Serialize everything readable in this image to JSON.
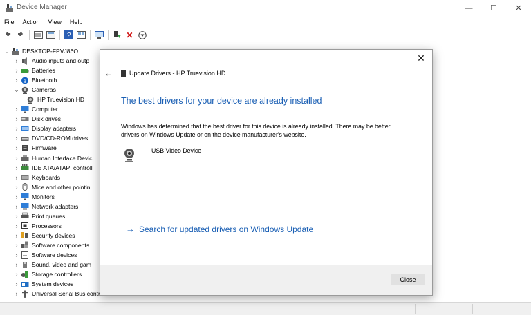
{
  "window": {
    "title": "Device Manager"
  },
  "menu": [
    "File",
    "Action",
    "View",
    "Help"
  ],
  "tree": {
    "root": "DESKTOP-FPVJ86O",
    "items": [
      {
        "label": "Audio inputs and outp",
        "icon": "speaker-icon"
      },
      {
        "label": "Batteries",
        "icon": "battery-icon"
      },
      {
        "label": "Bluetooth",
        "icon": "bluetooth-icon"
      },
      {
        "label": "Cameras",
        "icon": "camera-icon"
      },
      {
        "label": "HP Truevision HD",
        "icon": "webcam-icon"
      },
      {
        "label": "Computer",
        "icon": "monitor-icon"
      },
      {
        "label": "Disk drives",
        "icon": "disk-icon"
      },
      {
        "label": "Display adapters",
        "icon": "display-icon"
      },
      {
        "label": "DVD/CD-ROM drives",
        "icon": "dvd-icon"
      },
      {
        "label": "Firmware",
        "icon": "firmware-icon"
      },
      {
        "label": "Human Interface Devic",
        "icon": "hid-icon"
      },
      {
        "label": "IDE ATA/ATAPI controll",
        "icon": "ide-icon"
      },
      {
        "label": "Keyboards",
        "icon": "keyboard-icon"
      },
      {
        "label": "Mice and other pointin",
        "icon": "mouse-icon"
      },
      {
        "label": "Monitors",
        "icon": "monitor-icon"
      },
      {
        "label": "Network adapters",
        "icon": "network-icon"
      },
      {
        "label": "Print queues",
        "icon": "printer-icon"
      },
      {
        "label": "Processors",
        "icon": "cpu-icon"
      },
      {
        "label": "Security devices",
        "icon": "security-icon"
      },
      {
        "label": "Software components",
        "icon": "component-icon"
      },
      {
        "label": "Software devices",
        "icon": "software-icon"
      },
      {
        "label": "Sound, video and gam",
        "icon": "sound-icon"
      },
      {
        "label": "Storage controllers",
        "icon": "storage-icon"
      },
      {
        "label": "System devices",
        "icon": "system-icon"
      },
      {
        "label": "Universal Serial Bus controllers",
        "icon": "usb-icon"
      }
    ]
  },
  "dialog": {
    "title": "Update Drivers - HP Truevision HD",
    "heading": "The best drivers for your device are already installed",
    "description": "Windows has determined that the best driver for this device is already installed. There may be better drivers on Windows Update or on the device manufacturer's website.",
    "device_name": "USB Video Device",
    "link": "Search for updated drivers on Windows Update",
    "close_button": "Close"
  },
  "colors": {
    "accent": "#1a5fb4",
    "footer": "#f0f0f0"
  }
}
